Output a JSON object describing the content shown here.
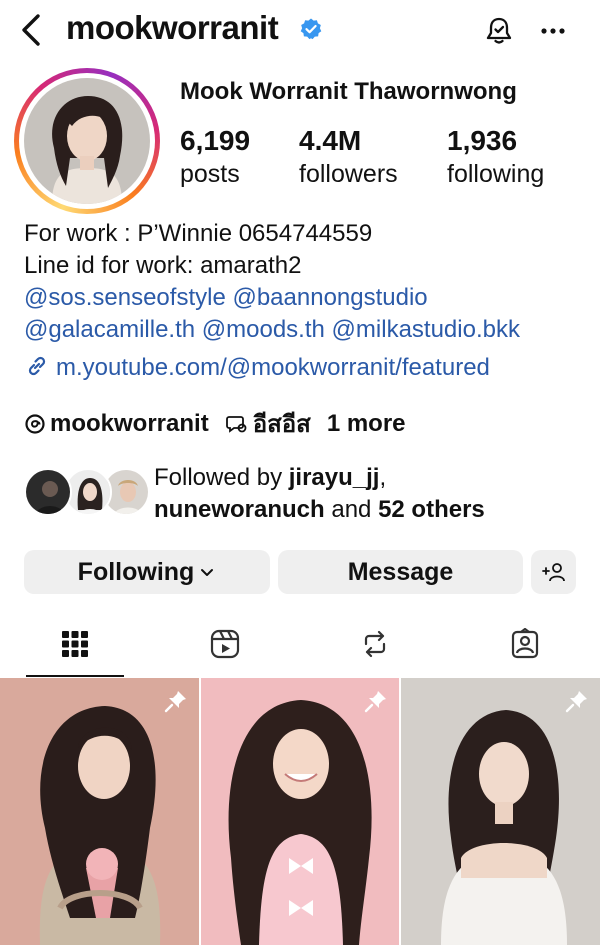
{
  "header": {
    "username": "mookworranit",
    "back_icon": "chevron-left-icon",
    "verified_icon": "verified-badge-icon",
    "notification_icon": "bell-icon",
    "more_icon": "more-horizontal-icon"
  },
  "profile": {
    "full_name": "Mook Worranit Thawornwong",
    "stats": [
      {
        "value": "6,199",
        "label": "posts"
      },
      {
        "value": "4.4M",
        "label": "followers"
      },
      {
        "value": "1,936",
        "label": "following"
      }
    ],
    "bio": {
      "line1": "For work : P’Winnie 0654744559",
      "line2": "Line id for work: amarath2",
      "mentions_row1": [
        "@sos.senseofstyle",
        "@baannongstudio"
      ],
      "mentions_row2": [
        "@galacamille.th",
        "@moods.th",
        "@milkastudio.bkk"
      ]
    },
    "link": "m.youtube.com/@mookworranit/featured",
    "chips": {
      "threads": "mookworranit",
      "thai_tag": "อีสอีส",
      "more": "1 more"
    }
  },
  "followed_by": {
    "prefix": "Followed by ",
    "user1": "jirayu_jj",
    "comma": ",",
    "user2": "nuneworanuch",
    "middle": " and ",
    "others": "52 others"
  },
  "actions": {
    "following": "Following",
    "message": "Message",
    "add_user_icon": "add-person-icon"
  },
  "tabs": [
    {
      "icon": "grid-icon",
      "active": true
    },
    {
      "icon": "reels-icon",
      "active": false
    },
    {
      "icon": "repost-icon",
      "active": false
    },
    {
      "icon": "tagged-icon",
      "active": false
    }
  ],
  "posts": [
    {
      "pinned": true
    },
    {
      "pinned": true
    },
    {
      "pinned": true
    }
  ],
  "colors": {
    "link": "#2b5aa8",
    "verified": "#3897f0",
    "button_bg": "#efefef"
  }
}
